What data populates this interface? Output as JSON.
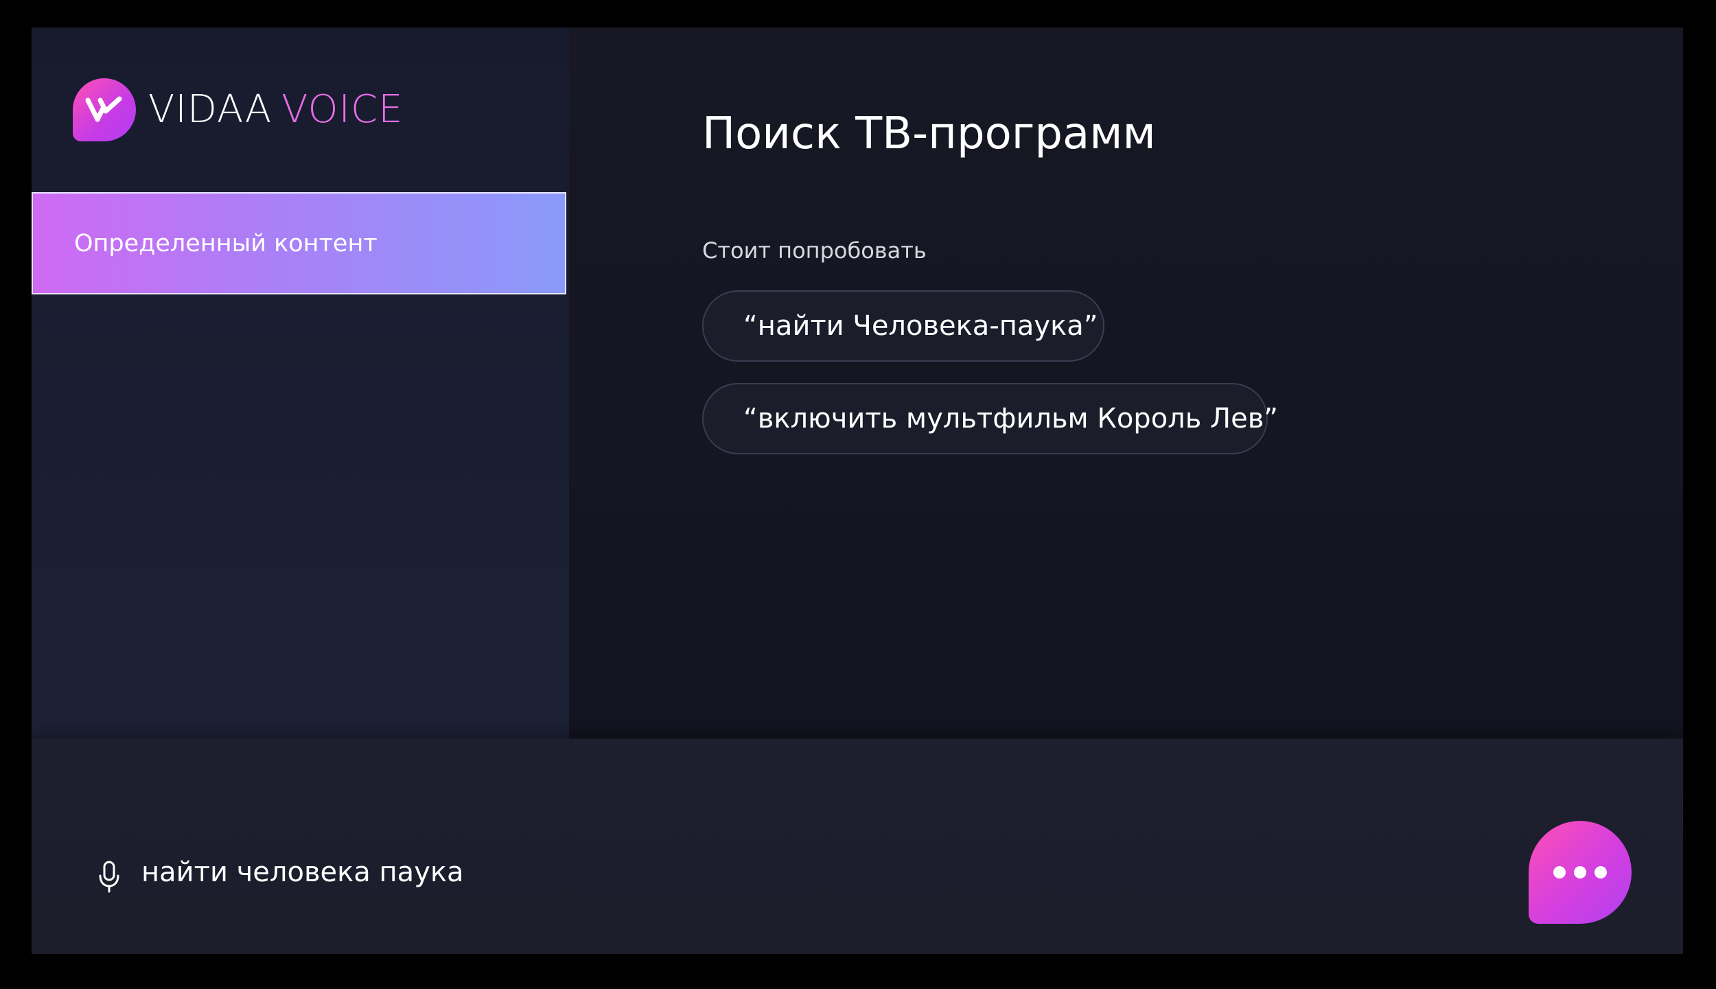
{
  "logo": {
    "brand": "VIDAA",
    "product": "VOICE"
  },
  "sidebar": {
    "items": [
      {
        "label": "Определенный контент",
        "selected": true
      }
    ]
  },
  "main": {
    "title": "Поиск ТВ-программ",
    "try_label": "Стоит попробовать",
    "suggestions": [
      "“найти Человека-паука”",
      "“включить мультфильм Король Лев”"
    ]
  },
  "voice_bar": {
    "query": "найти человека паука",
    "mic_icon": "microphone-icon",
    "assistant_icon": "more-dots-icon"
  },
  "colors": {
    "accent_pink": "#ff4fb4",
    "accent_purple": "#b13df0",
    "selected_gradient_start": "#cf6af3",
    "selected_gradient_end": "#8a9afb",
    "background": "#14151f"
  }
}
